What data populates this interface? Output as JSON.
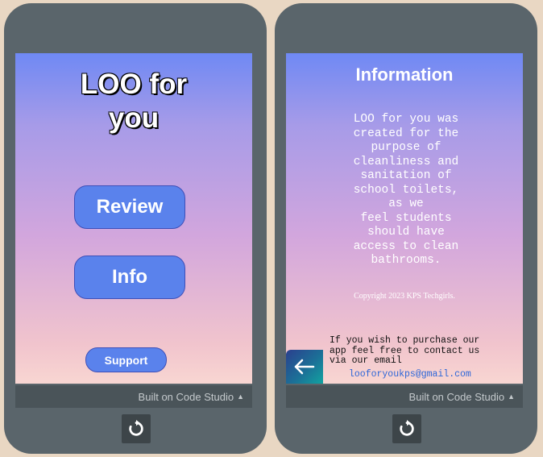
{
  "left_phone": {
    "app_title_line1": "LOO for",
    "app_title_line2": "you",
    "review_button": "Review",
    "info_button": "Info",
    "support_button": "Support",
    "footer_label": "Built on Code Studio",
    "footer_caret_icon": "caret-up-icon",
    "reset_icon": "reset-icon"
  },
  "right_phone": {
    "heading": "Information",
    "body_lines": [
      "LOO for you was",
      "created for the",
      "purpose of",
      "cleanliness and",
      "sanitation of",
      "school toilets,",
      "as we",
      "feel students",
      "should have",
      "access to clean",
      "bathrooms."
    ],
    "copyright": "Copyright 2023 KPS Techgirls.",
    "contact_lines": [
      "If you wish to purchase our",
      "app feel free to contact us",
      "via our email"
    ],
    "email": "looforyoukps@gmail.com",
    "back_icon": "arrow-left-icon",
    "footer_label": "Built on Code Studio",
    "reset_icon": "reset-icon"
  },
  "colors": {
    "background": "#e9d7c3",
    "phone": "#5a656b",
    "button": "#5a82ec",
    "email_link": "#2c66d8"
  }
}
